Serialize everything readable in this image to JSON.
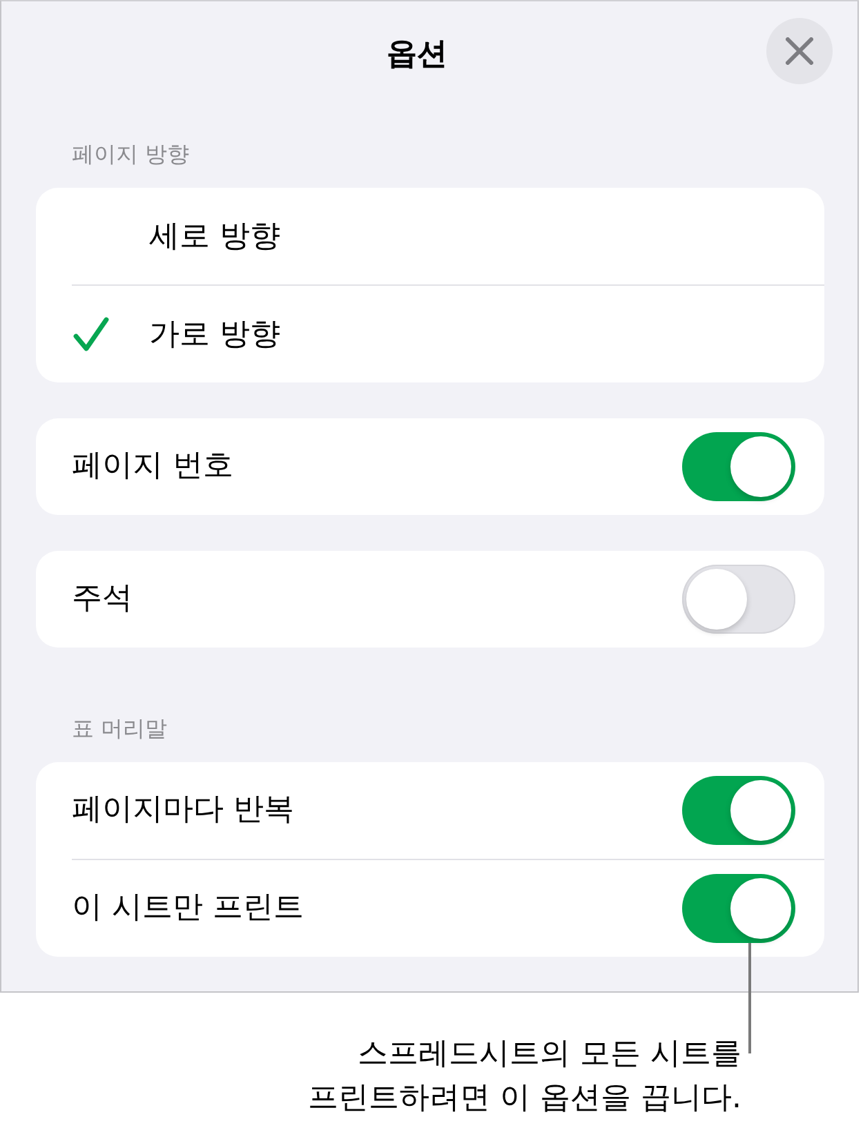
{
  "dialog": {
    "title": "옵션"
  },
  "groups": [
    {
      "header": "페이지 방향",
      "rows": [
        {
          "kind": "choice",
          "label": "세로 방향",
          "selected": false
        },
        {
          "kind": "choice",
          "label": "가로 방향",
          "selected": true
        }
      ]
    },
    {
      "rows": [
        {
          "kind": "toggle",
          "label": "페이지 번호",
          "on": true
        }
      ]
    },
    {
      "rows": [
        {
          "kind": "toggle",
          "label": "주석",
          "on": false
        }
      ]
    },
    {
      "header": "표 머리말",
      "rows": [
        {
          "kind": "toggle",
          "label": "페이지마다 반복",
          "on": true
        },
        {
          "kind": "toggle",
          "label": "이 시트만 프린트",
          "on": true
        }
      ]
    }
  ],
  "callout": {
    "lines": [
      "스프레드시트의 모든 시트를",
      "프린트하려면 이 옵션을 끕니다."
    ]
  }
}
